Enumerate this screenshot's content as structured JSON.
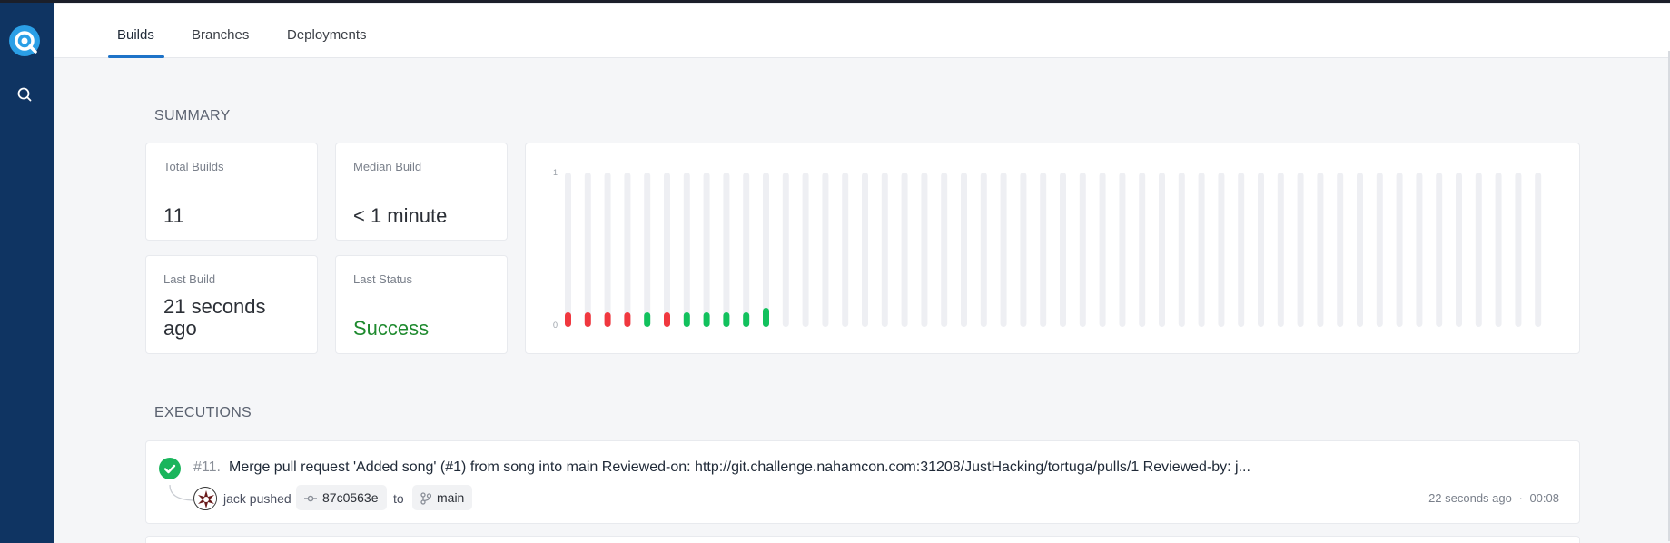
{
  "tabs": [
    {
      "label": "Builds",
      "active": true
    },
    {
      "label": "Branches",
      "active": false
    },
    {
      "label": "Deployments",
      "active": false
    }
  ],
  "summary": {
    "title": "SUMMARY",
    "total_builds_label": "Total Builds",
    "total_builds_value": "11",
    "median_build_label": "Median Build",
    "median_build_value": "< 1 minute",
    "last_build_label": "Last Build",
    "last_build_value_line1": "21 seconds",
    "last_build_value_line2": "ago",
    "last_status_label": "Last Status",
    "last_status_value": "Success"
  },
  "chart_data": {
    "type": "bar",
    "ylim": [
      0,
      1
    ],
    "y_ticks": [
      "1",
      "0"
    ],
    "slots": 50,
    "builds": [
      "failure",
      "failure",
      "failure",
      "failure",
      "success",
      "failure",
      "success",
      "success",
      "success",
      "success",
      "success"
    ],
    "colors": {
      "success": "#12c15d",
      "failure": "#f0383f",
      "empty": "#eeeff3"
    }
  },
  "executions": {
    "title": "EXECUTIONS",
    "items": [
      {
        "number": "#11.",
        "message": "Merge pull request 'Added song' (#1) from song into main Reviewed-on: http://git.challenge.nahamcon.com:31208/JustHacking/tortuga/pulls/1 Reviewed-by: j...",
        "author_text": "jack pushed",
        "commit": "87c0563e",
        "to_text": "to",
        "branch": "main",
        "time_ago": "22 seconds ago",
        "separator": "·",
        "duration": "00:08",
        "status": "success"
      }
    ]
  }
}
